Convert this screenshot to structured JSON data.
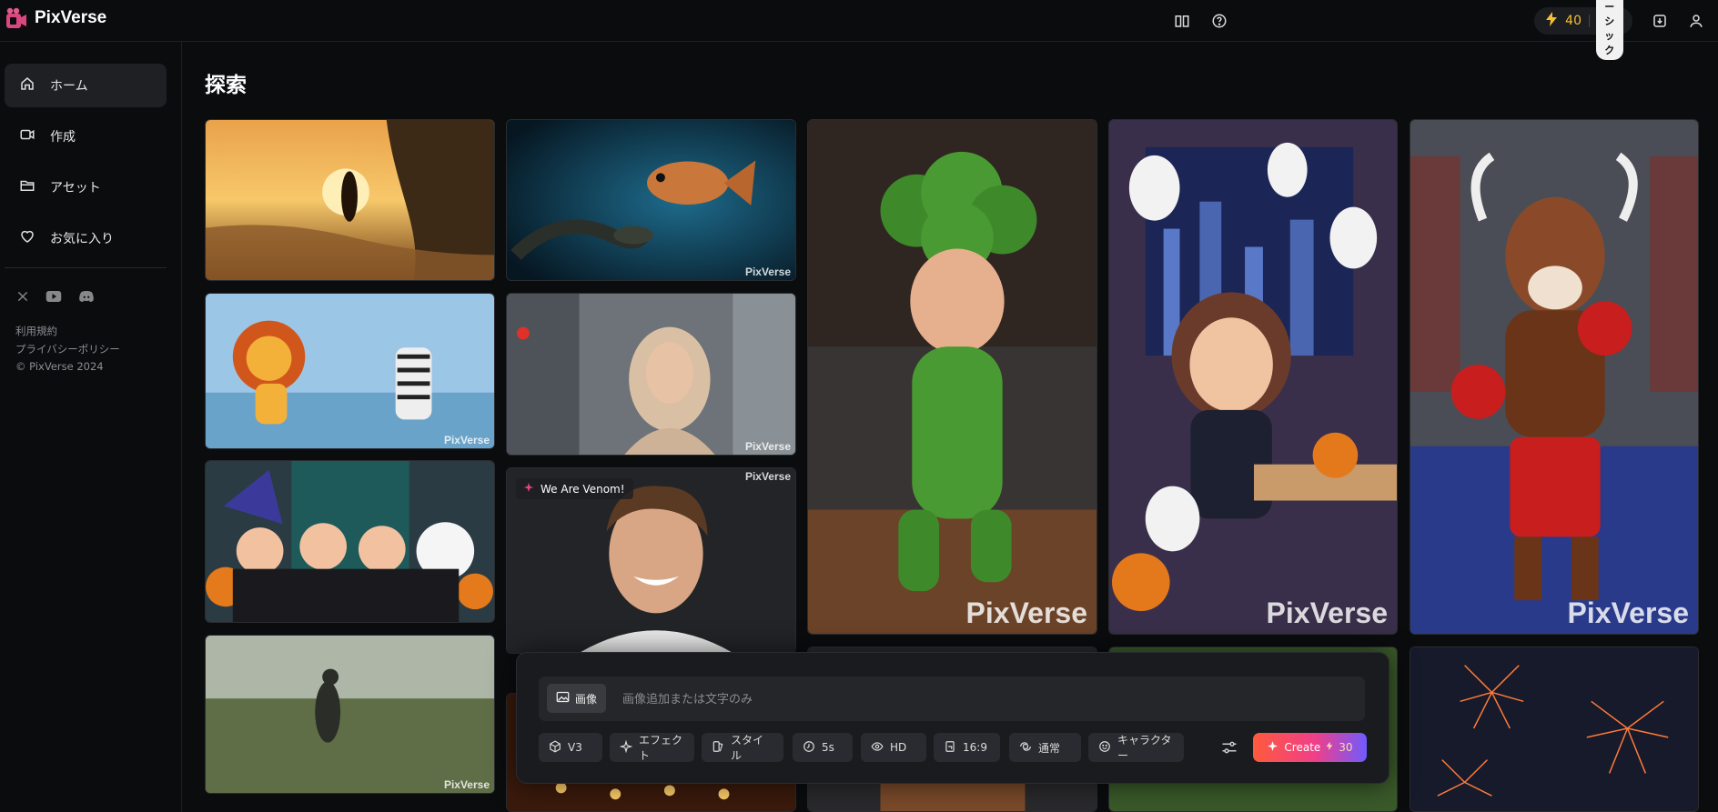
{
  "app": {
    "name": "PixVerse"
  },
  "header": {
    "credits": "40",
    "plan": "ベーシック"
  },
  "sidebar": {
    "items": [
      {
        "label": "ホーム",
        "icon": "home-icon"
      },
      {
        "label": "作成",
        "icon": "video-icon"
      },
      {
        "label": "アセット",
        "icon": "folder-icon"
      },
      {
        "label": "お気に入り",
        "icon": "heart-icon"
      }
    ],
    "social": [
      "x-icon",
      "youtube-icon",
      "discord-icon"
    ],
    "footer": {
      "terms": "利用規約",
      "privacy": "プライバシーポリシー",
      "copyright": "© PixVerse 2024"
    }
  },
  "main": {
    "title": "探索",
    "watermark": "PixVerse",
    "featured_badge": "We Are Venom!",
    "cards": [
      {
        "subject": "sunset-beach-runner"
      },
      {
        "subject": "snake-and-fish"
      },
      {
        "subject": "broccoli-baby"
      },
      {
        "subject": "halloween-girl-laptop"
      },
      {
        "subject": "boxing-bull"
      },
      {
        "subject": "lion-and-zebra"
      },
      {
        "subject": "woman-in-hijab"
      },
      {
        "subject": "halloween-kids"
      },
      {
        "subject": "smiling-young-man"
      },
      {
        "subject": "foggy-meadow-walker"
      },
      {
        "subject": "fireworks"
      }
    ]
  },
  "composer": {
    "image_button": "画像",
    "placeholder": "画像追加または文字のみ",
    "options": [
      "V3",
      "エフェクト",
      "スタイル",
      "5s",
      "HD",
      "16:9",
      "通常",
      "キャラクター"
    ],
    "create_label": "Create",
    "create_cost": "30"
  }
}
